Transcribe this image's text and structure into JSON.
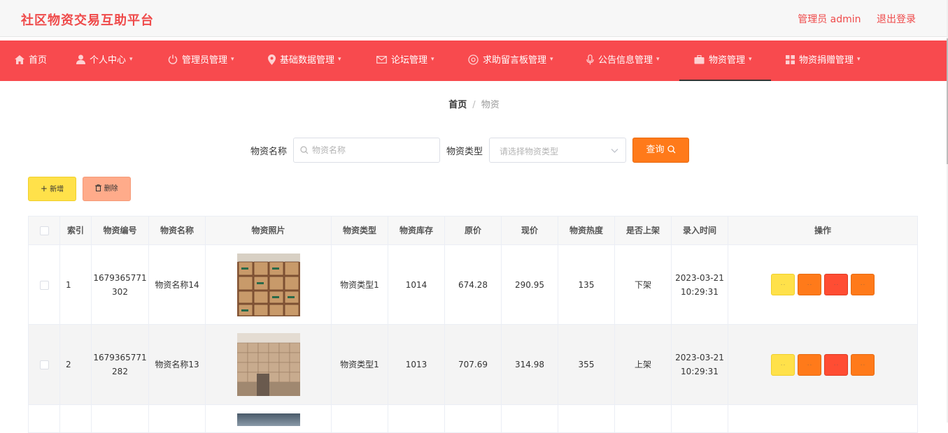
{
  "header": {
    "title": "社区物资交易互助平台",
    "user_label": "管理员 admin",
    "logout_label": "退出登录"
  },
  "nav": {
    "items": [
      {
        "label": "首页",
        "icon": "home-icon"
      },
      {
        "label": "个人中心",
        "icon": "user-icon"
      },
      {
        "label": "管理员管理",
        "icon": "power-icon"
      },
      {
        "label": "基础数据管理",
        "icon": "location-pin-icon"
      },
      {
        "label": "论坛管理",
        "icon": "mail-icon"
      },
      {
        "label": "求助留言板管理",
        "icon": "help-circle-icon"
      },
      {
        "label": "公告信息管理",
        "icon": "microphone-icon"
      },
      {
        "label": "物资管理",
        "icon": "briefcase-icon"
      },
      {
        "label": "物资捐赠管理",
        "icon": "grid-icon"
      }
    ],
    "active_index": 7
  },
  "breadcrumb": {
    "home": "首页",
    "separator": "/",
    "current": "物资"
  },
  "search": {
    "name_label": "物资名称",
    "name_placeholder": "物资名称",
    "type_label": "物资类型",
    "type_placeholder": "请选择物资类型",
    "query_label": "查询"
  },
  "actions": {
    "add_label": "新增",
    "delete_label": "删除"
  },
  "table": {
    "headers": [
      "索引",
      "物资编号",
      "物资名称",
      "物资照片",
      "物资类型",
      "物资库存",
      "原价",
      "现价",
      "物资热度",
      "是否上架",
      "录入时间",
      "操作"
    ],
    "rows": [
      {
        "index": "1",
        "code": "1679365771302",
        "name": "物资名称14",
        "type": "物资类型1",
        "stock": "1014",
        "original_price": "674.28",
        "current_price": "290.95",
        "heat": "135",
        "on_shelf": "下架",
        "created_at": "2023-03-21 10:29:31"
      },
      {
        "index": "2",
        "code": "1679365771282",
        "name": "物资名称13",
        "type": "物资类型1",
        "stock": "1013",
        "original_price": "707.69",
        "current_price": "314.98",
        "heat": "355",
        "on_shelf": "上架",
        "created_at": "2023-03-21 10:29:31"
      }
    ]
  },
  "colors": {
    "brand": "#f84a4e",
    "title": "#ef4a4a",
    "primary_orange": "#ff7a1a",
    "yellow": "#ffe14a",
    "danger": "#ff4d33"
  }
}
